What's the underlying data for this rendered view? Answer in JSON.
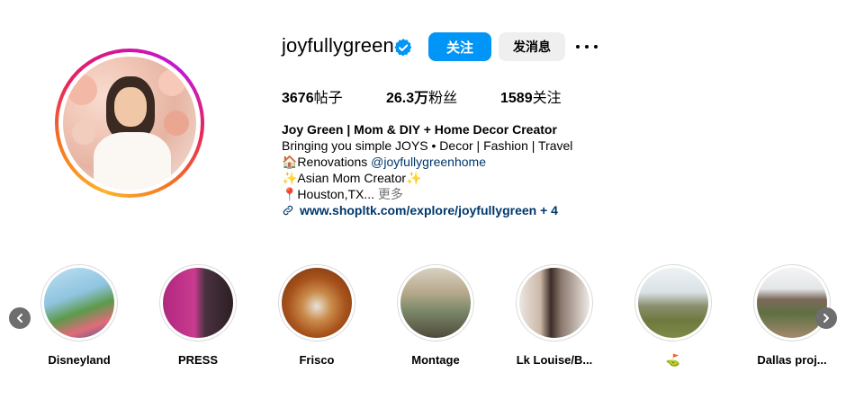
{
  "profile": {
    "username": "joyfullygreen",
    "follow_label": "关注",
    "message_label": "发消息"
  },
  "stats": {
    "posts_count": "3676",
    "posts_label": "帖子",
    "followers_count": "26.3万",
    "followers_label": "粉丝",
    "following_count": "1589",
    "following_label": "关注"
  },
  "bio": {
    "name": "Joy Green | Mom & DIY + Home Decor Creator",
    "line1": "Bringing you simple JOYS • Decor | Fashion | Travel",
    "line2_prefix": "🏠Renovations ",
    "line2_mention": "@joyfullygreenhome",
    "line3": "✨Asian Mom Creator✨",
    "line4": "📍Houston,TX... ",
    "more_label": "更多",
    "link": "www.shopltk.com/explore/joyfullygreen + 4"
  },
  "highlights": [
    {
      "label": "Disneyland"
    },
    {
      "label": "PRESS"
    },
    {
      "label": "Frisco"
    },
    {
      "label": "Montage"
    },
    {
      "label": "Lk Louise/B..."
    },
    {
      "label": "⛳"
    },
    {
      "label": "Dallas proj..."
    }
  ],
  "colors": {
    "primary": "#0095f6",
    "link": "#00376b",
    "muted": "#737373",
    "secondary_button": "#efefef"
  },
  "icons": [
    "verified-badge-icon",
    "more-options-icon",
    "link-icon",
    "chevron-left-icon",
    "chevron-right-icon"
  ]
}
